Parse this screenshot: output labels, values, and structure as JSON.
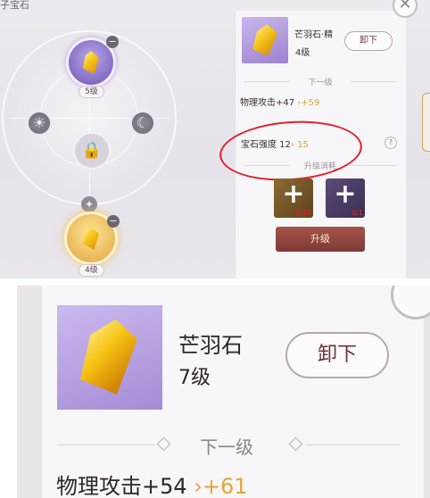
{
  "top": {
    "page_title": "子宝石",
    "wheel": {
      "top_slot_level": "5级",
      "bottom_slot_level": "4级",
      "left_icon": "sun-icon",
      "right_icon": "moon-icon",
      "center_icon": "lock-icon"
    },
    "panel": {
      "gem_name": "芒羽石·精",
      "gem_level": "4级",
      "unequip_label": "卸下",
      "next_level_label": "下一级",
      "stat_text": "物理攻击+47",
      "stat_next": "+59",
      "strength_label": "宝石强度 12",
      "strength_next": "15",
      "help_label": "?",
      "cost_label": "升级消耗",
      "materials": [
        {
          "count": "0/10",
          "icon": "plus-icon"
        },
        {
          "count": "0/1",
          "icon": "plus-icon"
        }
      ],
      "upgrade_label": "升级"
    },
    "close_icon": "close-icon"
  },
  "bottom": {
    "gem_name": "芒羽石",
    "gem_level": "7级",
    "unequip_label": "卸下",
    "next_level_label": "下一级",
    "stat_text": "物理攻击+54",
    "stat_next": "+61"
  },
  "colors": {
    "accent_gold": "#e4a536",
    "annotation_red": "#e0202a",
    "upgrade_button": "#8f4640",
    "gem_bg_purple": "#b9a3e4"
  }
}
